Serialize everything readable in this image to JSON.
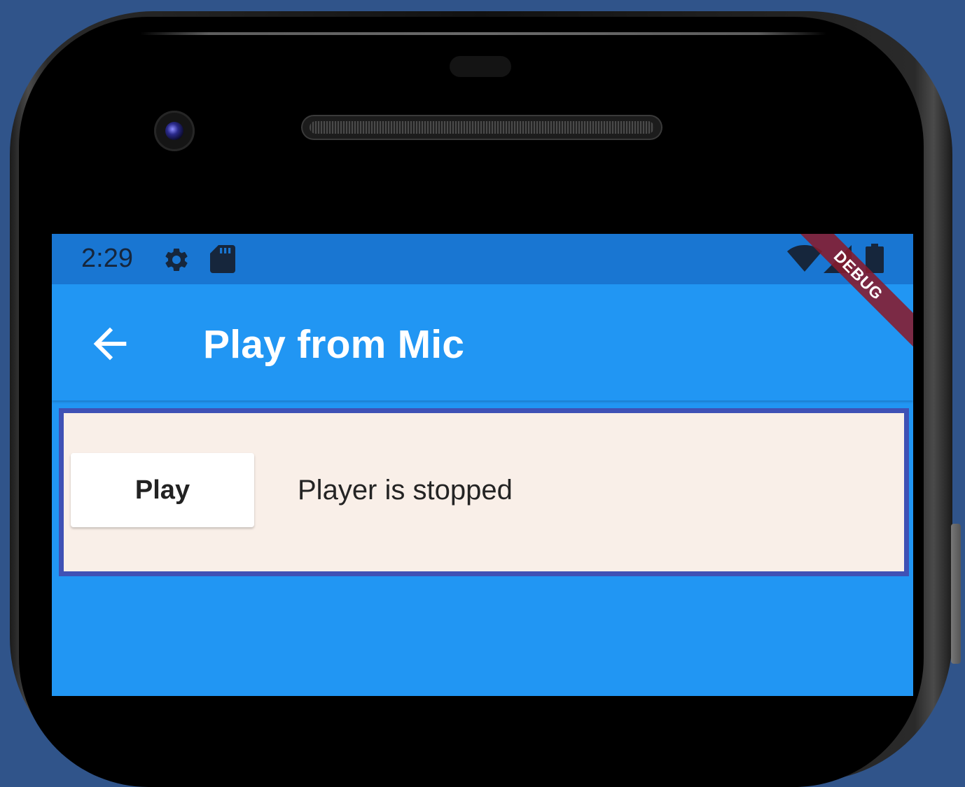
{
  "status_bar": {
    "time": "2:29",
    "icons": [
      "settings-icon",
      "sd-card-icon",
      "wifi-icon",
      "signal-icon",
      "battery-icon"
    ]
  },
  "app_bar": {
    "title": "Play from Mic",
    "back_icon": "back-arrow-icon"
  },
  "debug_banner": "DEBUG",
  "player": {
    "play_label": "Play",
    "status_text": "Player is stopped"
  },
  "colors": {
    "app_bar": "#2196f3",
    "status_bar": "#1976d2",
    "panel_background": "#f9efe8",
    "panel_border": "#3f51b5",
    "debug_banner": "#881b2c"
  }
}
